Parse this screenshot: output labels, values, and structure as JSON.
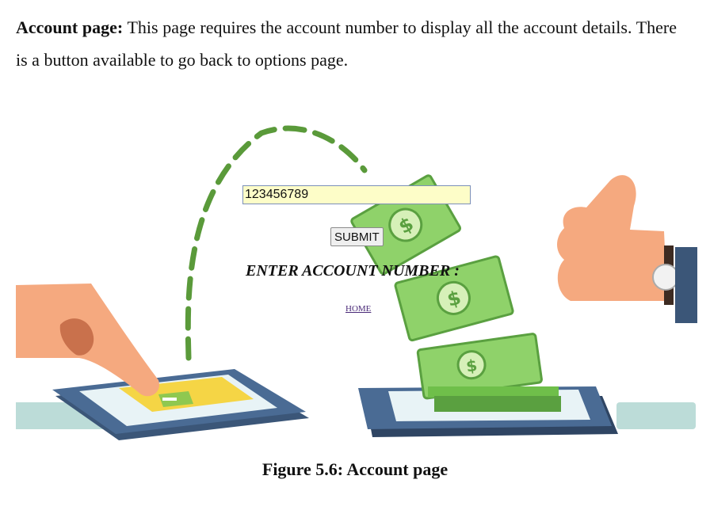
{
  "paragraph": {
    "heading": "Account page:",
    "text": "This page requires the account number to display all the account details. There is a button available to go back to options page."
  },
  "form": {
    "prompt": "ENTER ACCOUNT NUMBER :",
    "account_number_value": "123456789",
    "submit_label": "SUBMIT",
    "home_link": "HOME"
  },
  "caption": "Figure 5.6: Account page",
  "colors": {
    "input_background": "#fdfdc8",
    "dashed_arrow": "#5a9a3a",
    "phone_body": "#3b5678",
    "money": "#8fd26a",
    "skin": "#f5a97f"
  }
}
